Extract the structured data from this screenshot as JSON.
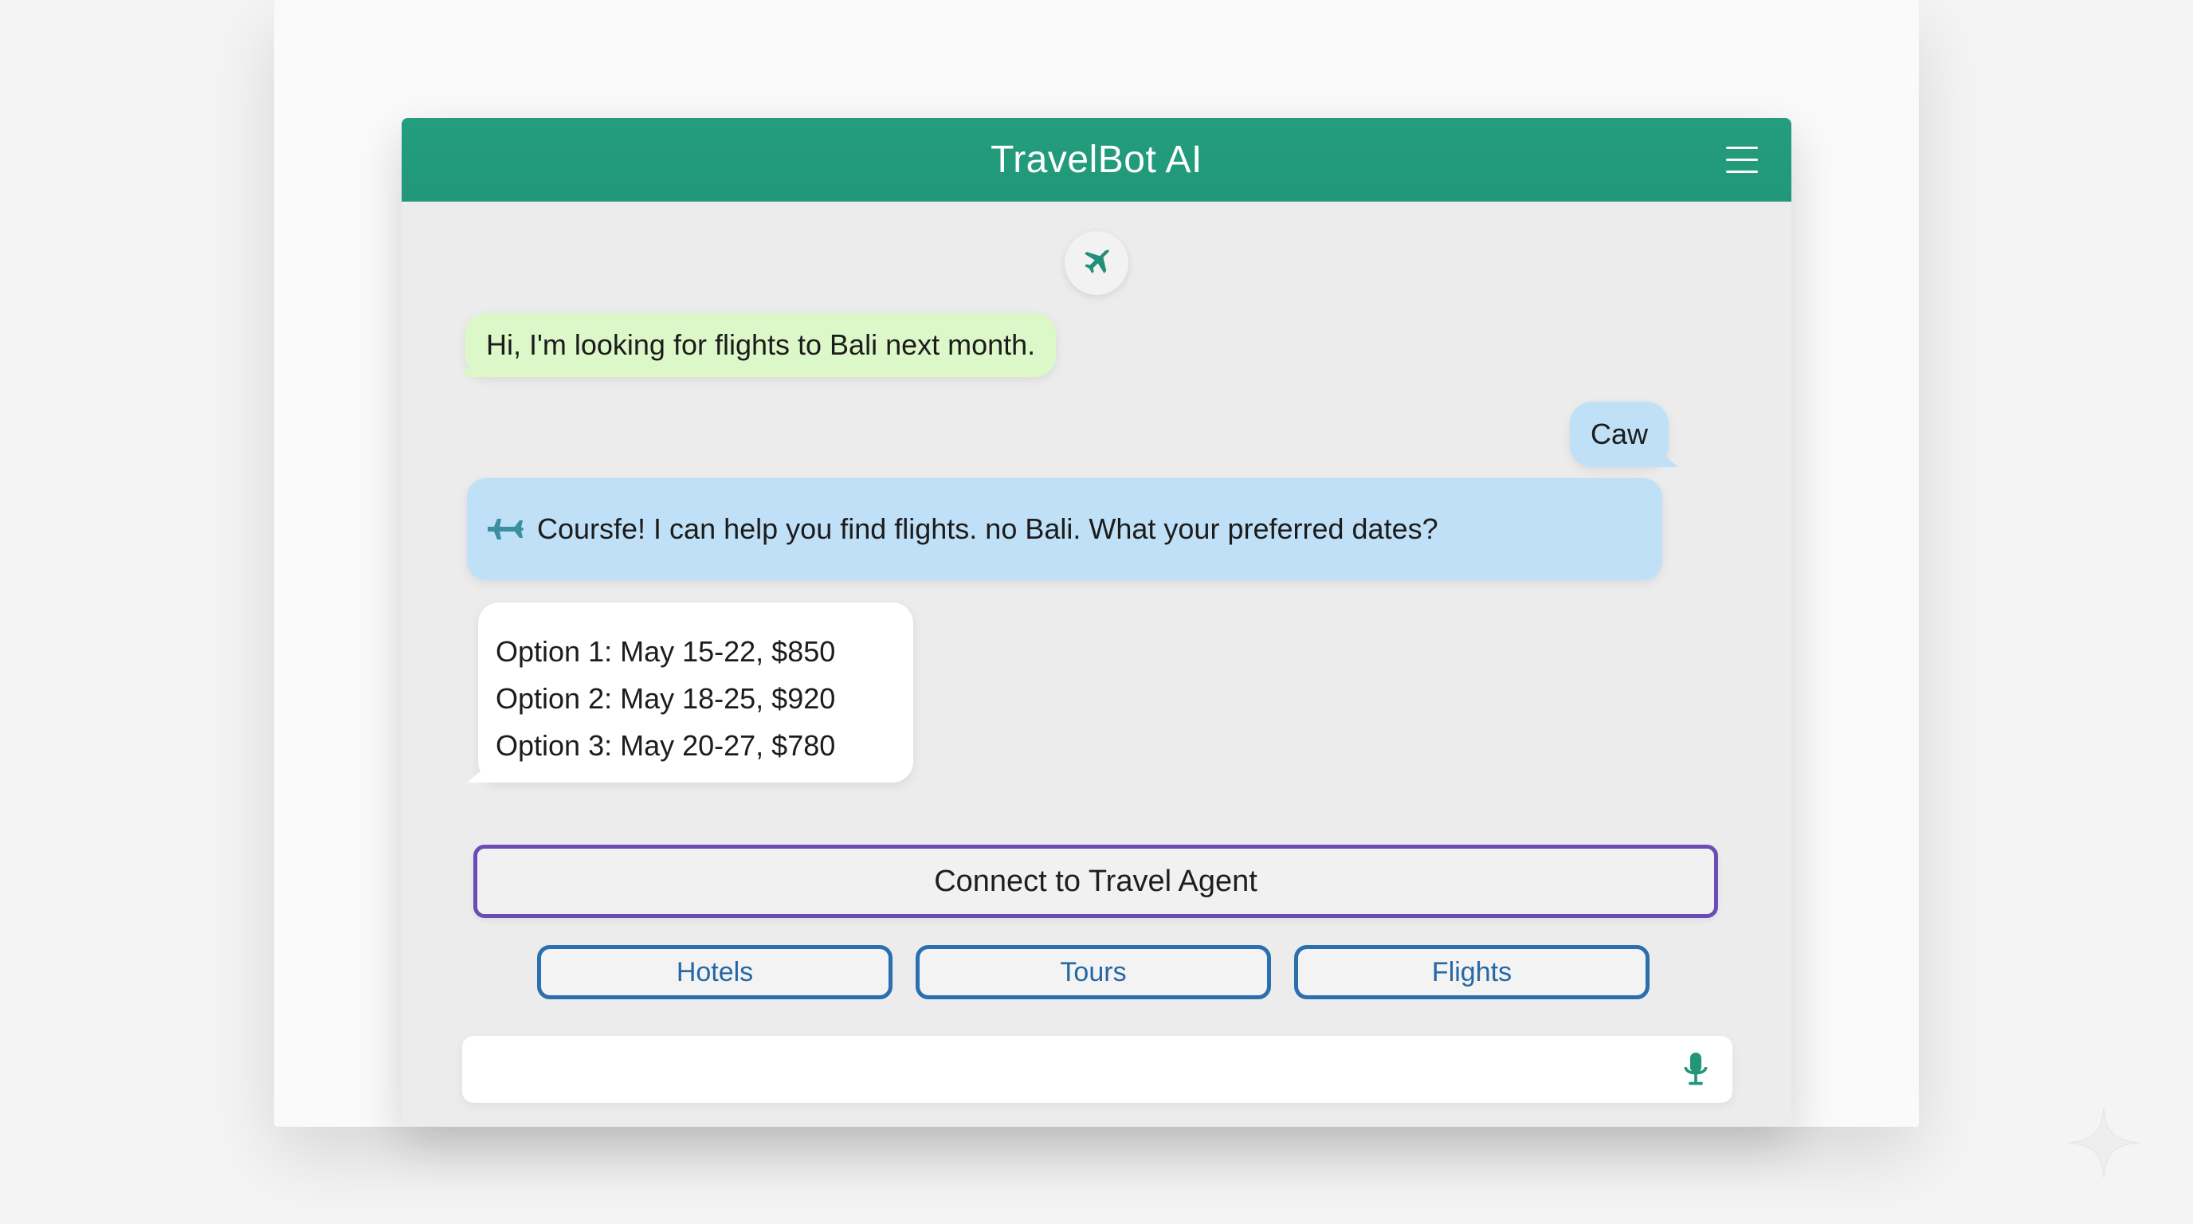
{
  "header": {
    "title": "TravelBot AI",
    "menu_icon": "hamburger-menu-icon",
    "color": "#249c7e"
  },
  "avatar": {
    "icon": "airplane-icon"
  },
  "messages": [
    {
      "from": "user",
      "text": "Hi, I'm looking for flights to Bali next month.",
      "color": "#dcf8c8"
    },
    {
      "from": "right",
      "text": "Caw",
      "color": "#bfe0f6"
    },
    {
      "from": "bot",
      "text": "Coursfe! I can help you find flights. no Bali. What your preferred dates?",
      "icon": "airplane-icon",
      "color": "#bfe0f6"
    },
    {
      "from": "bot",
      "lines": [
        "Option 1: May 15-22, $850",
        "Option 2: May 18-25, $920",
        "Option 3: May 20-27, $780"
      ],
      "color": "#ffffff"
    }
  ],
  "actions": {
    "connect_label": "Connect to Travel Agent",
    "connect_border_color": "#6b4bb6",
    "quick_replies": [
      "Hotels",
      "Tours",
      "Flights"
    ],
    "quick_reply_color": "#2a6fae"
  },
  "input": {
    "value": "",
    "placeholder": "",
    "mic_icon": "microphone-icon"
  }
}
